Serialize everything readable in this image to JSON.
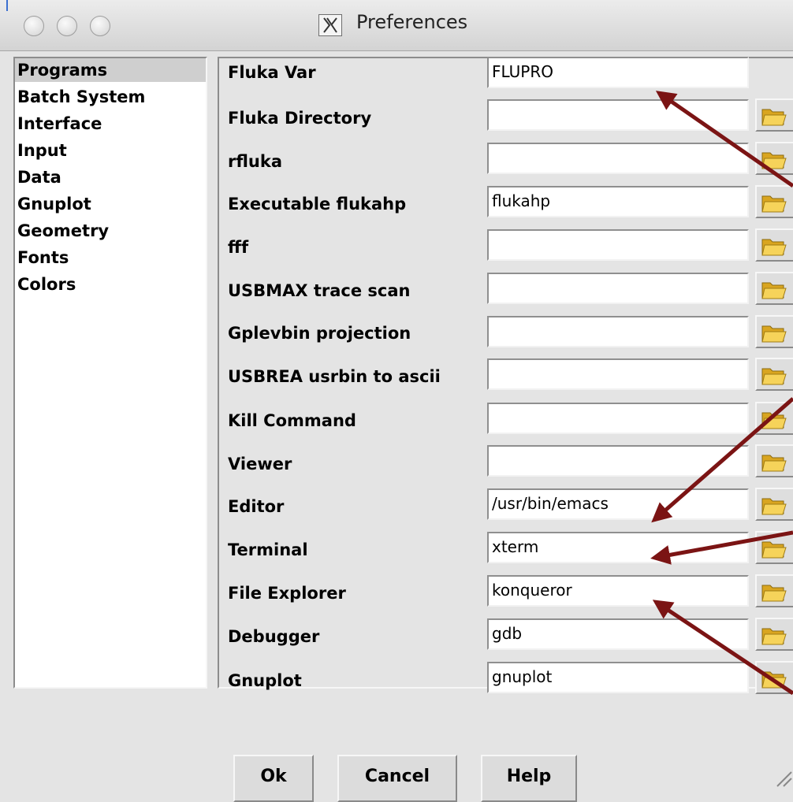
{
  "window": {
    "title": "Preferences",
    "x11_glyph": "X",
    "traffic_lights": [
      "close",
      "minimize",
      "zoom"
    ]
  },
  "sidebar": {
    "selected": "Programs",
    "items": [
      "Programs",
      "Batch System",
      "Interface",
      "Input",
      "Data",
      "Gnuplot",
      "Geometry",
      "Fonts",
      "Colors"
    ]
  },
  "form": {
    "rows": [
      {
        "label": "Fluka Var",
        "value": "FLUPRO",
        "browse_button": false
      },
      {
        "label": "Fluka Directory",
        "value": "",
        "browse_button": true
      },
      {
        "label": "rfluka",
        "value": "",
        "browse_button": true
      },
      {
        "label": "Executable flukahp",
        "value": "flukahp",
        "browse_button": true
      },
      {
        "label": "fff",
        "value": "",
        "browse_button": true
      },
      {
        "label": "USBMAX trace scan",
        "value": "",
        "browse_button": true
      },
      {
        "label": "Gplevbin projection",
        "value": "",
        "browse_button": true
      },
      {
        "label": "USBREA usrbin to ascii",
        "value": "",
        "browse_button": true
      },
      {
        "label": "Kill Command",
        "value": "",
        "browse_button": true
      },
      {
        "label": "Viewer",
        "value": "",
        "browse_button": true
      },
      {
        "label": "Editor",
        "value": "/usr/bin/emacs",
        "browse_button": true
      },
      {
        "label": "Terminal",
        "value": "xterm",
        "browse_button": true
      },
      {
        "label": "File Explorer",
        "value": "konqueror",
        "browse_button": true
      },
      {
        "label": "Debugger",
        "value": "gdb",
        "browse_button": true
      },
      {
        "label": "Gnuplot",
        "value": "gnuplot",
        "browse_button": true
      }
    ],
    "browse_icon": "folder-open-icon"
  },
  "buttons": {
    "ok": "Ok",
    "cancel": "Cancel",
    "help": "Help"
  },
  "annotations": {
    "arrow_color": "#7b1414",
    "arrow_targets": [
      "Fluka Var",
      "Editor",
      "Terminal",
      "File Explorer"
    ]
  },
  "colors": {
    "window_bg": "#e4e4e4",
    "selection_bg": "#cfcfcf",
    "field_bg": "#ffffff",
    "folder_icon": "#f0c040"
  }
}
